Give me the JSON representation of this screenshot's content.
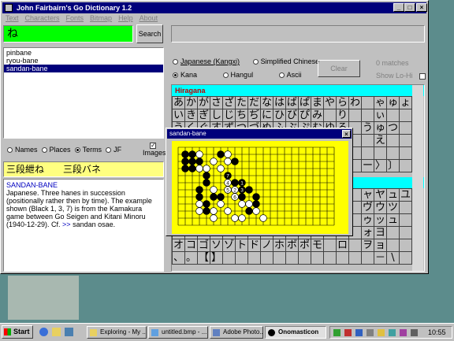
{
  "window": {
    "title": "John Fairbairn's Go Dictionary 1.2",
    "controls": [
      "_",
      "□",
      "×"
    ]
  },
  "menu": [
    "Text",
    "Characters",
    "Fonts",
    "Bitmap",
    "Help",
    "About"
  ],
  "search": {
    "value": "ね",
    "button": "Search"
  },
  "results": [
    "pinbane",
    "ryou-bane",
    "sandan-bane"
  ],
  "selected_result": 2,
  "filters": {
    "options": [
      "Names",
      "Places",
      "Terms",
      "JF"
    ],
    "selected": 2,
    "images_label": "Images",
    "images_checked": true
  },
  "headword": "三段紲ね　　三段バネ",
  "definition": {
    "term": "SANDAN-BANE",
    "text": "Japanese. Three hanes in succession (positionally rather then by time). The example shown (Black 1, 3, 7) is from the Kamakura game between Go Seigen and Kitani Minoru (1940-12-29). Cf. ",
    "link_arrow": ">>",
    "link_text": "sandan osae."
  },
  "script_options": {
    "row1": [
      "Japanese (Kangxi)",
      "Simplified Chinese"
    ],
    "row2": [
      "Kana",
      "Hangul",
      "Ascii"
    ],
    "selected": "Kana"
  },
  "clear_button": "Clear",
  "match_text": "0 matches",
  "show_lohi_label": "Show Lo-Hi",
  "hiragana": {
    "label": "Hiragana",
    "row1": [
      "あ",
      "か",
      "が",
      "さ",
      "ざ",
      "た",
      "だ",
      "な",
      "は",
      "ば",
      "ぱ",
      "ま",
      "や",
      "ら",
      "わ",
      "",
      "ゃ",
      "ゅ",
      "ょ"
    ],
    "row2": [
      "い",
      "き",
      "ぎ",
      "し",
      "じ",
      "ち",
      "ぢ",
      "に",
      "ひ",
      "び",
      "ぴ",
      "み",
      "",
      "り",
      "",
      "",
      "ぃ",
      "",
      ""
    ],
    "row3": [
      "う",
      "く",
      "ぐ",
      "す",
      "ず",
      "つ",
      "づ",
      "ぬ",
      "ふ",
      "ぶ",
      "ぷ",
      "む",
      "ゆ",
      "る",
      "",
      "う",
      "ゅ",
      "つ",
      ""
    ],
    "row4": [
      "",
      "",
      "",
      "",
      "",
      "",
      "",
      "",
      "",
      "",
      "",
      "",
      "",
      "",
      "",
      "",
      "え",
      "",
      ""
    ],
    "row5": [
      "",
      "",
      "",
      "",
      "",
      "",
      "",
      "",
      "",
      "",
      "",
      "",
      "",
      "",
      "",
      "",
      "",
      "",
      ""
    ],
    "row6": [
      "",
      "",
      "",
      "",
      "",
      "",
      "",
      "",
      "",
      "",
      "",
      "",
      "",
      "",
      "",
      "ー",
      "〉",
      "〕",
      ""
    ]
  },
  "katakana": {
    "label": "Katakana",
    "row1": [
      "",
      "",
      "",
      "",
      "",
      "",
      "",
      "",
      "",
      "",
      "",
      "",
      "",
      "",
      "",
      "ャ",
      "ヤ",
      "ュ",
      "ユ"
    ],
    "row2": [
      "",
      "",
      "",
      "",
      "",
      "",
      "",
      "",
      "",
      "",
      "",
      "",
      "",
      "",
      "",
      "ヴ",
      "ウ",
      "ツ",
      ""
    ],
    "row3": [
      "",
      "",
      "",
      "",
      "",
      "",
      "",
      "",
      "",
      "",
      "",
      "",
      "",
      "",
      "",
      "ゥ",
      "ッ",
      "ュ",
      ""
    ],
    "row4": [
      "",
      "",
      "",
      "",
      "",
      "",
      "",
      "",
      "",
      "",
      "",
      "",
      "",
      "",
      "",
      "ォ",
      "ヨ",
      "",
      ""
    ],
    "row5": [
      "オ",
      "コ",
      "ゴ",
      "ソ",
      "ゾ",
      "ト",
      "ド",
      "ノ",
      "ホ",
      "ボ",
      "ポ",
      "モ",
      "",
      "ロ",
      "",
      "ヲ",
      "ョ",
      "",
      ""
    ],
    "row6": [
      "、",
      "。",
      "【",
      "】",
      "",
      "",
      "",
      "",
      "",
      "",
      "",
      "",
      "",
      "",
      "",
      "",
      "－",
      "\\",
      ""
    ]
  },
  "board": {
    "title": "sandan-bane",
    "close": "×",
    "size": 13,
    "black": [
      [
        1,
        1
      ],
      [
        2,
        1
      ],
      [
        1,
        2
      ],
      [
        2,
        2
      ],
      [
        1,
        3
      ],
      [
        2,
        3
      ],
      [
        3,
        2
      ],
      [
        6,
        1
      ],
      [
        8,
        2
      ],
      [
        4,
        4
      ],
      [
        4,
        5
      ],
      [
        3,
        6
      ],
      [
        3,
        7
      ],
      [
        4,
        8
      ],
      [
        5,
        7
      ],
      [
        6,
        7
      ],
      [
        7,
        6
      ],
      [
        8,
        5
      ],
      [
        9,
        7
      ],
      [
        10,
        6
      ],
      [
        11,
        7
      ],
      [
        11,
        8
      ],
      [
        10,
        9
      ],
      [
        4,
        9
      ]
    ],
    "white": [
      [
        3,
        1
      ],
      [
        7,
        1
      ],
      [
        3,
        3
      ],
      [
        4,
        3
      ],
      [
        5,
        2
      ],
      [
        7,
        2
      ],
      [
        6,
        3
      ],
      [
        5,
        6
      ],
      [
        6,
        8
      ],
      [
        5,
        9
      ],
      [
        5,
        10
      ],
      [
        7,
        9
      ],
      [
        8,
        10
      ],
      [
        9,
        10
      ],
      [
        9,
        8
      ],
      [
        10,
        8
      ],
      [
        11,
        9
      ],
      [
        12,
        10
      ],
      [
        3,
        8
      ],
      [
        3,
        9
      ]
    ],
    "labels": [
      {
        "x": 7,
        "y": 4,
        "text": "7",
        "color": "black"
      },
      {
        "x": 7,
        "y": 5,
        "text": "4",
        "color": "white"
      },
      {
        "x": 7,
        "y": 6,
        "text": "5",
        "color": "white"
      },
      {
        "x": 8,
        "y": 6,
        "text": "2",
        "color": "white"
      },
      {
        "x": 9,
        "y": 6,
        "text": "3",
        "color": "black"
      },
      {
        "x": 9,
        "y": 5,
        "text": "1",
        "color": "black"
      },
      {
        "x": 8,
        "y": 7,
        "text": "6",
        "color": "white"
      }
    ]
  },
  "taskbar": {
    "start": "Start",
    "tasks": [
      "Exploring - My ...",
      "untitled.bmp - ...",
      "Adobe Photo...",
      "Onomasticon"
    ],
    "clock": "10:55"
  },
  "colors": {
    "titlebar": "#00007b",
    "search_bg": "#00ff00",
    "section_head": "#00ffff",
    "board": "#ffff00",
    "headword_bg": "#ffff80"
  }
}
